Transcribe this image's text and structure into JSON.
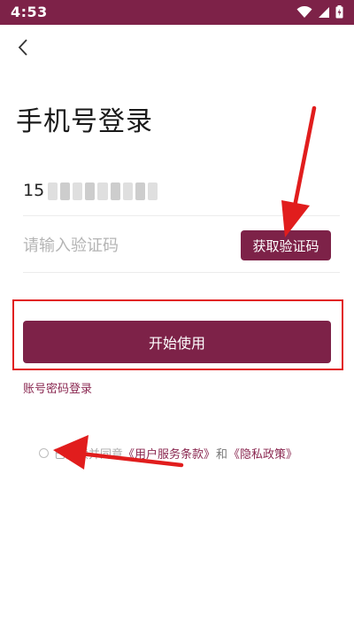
{
  "status_bar": {
    "time": "4:53",
    "icons": [
      "wifi-icon",
      "signal-icon",
      "battery-icon"
    ],
    "background": "#7d2248"
  },
  "header": {
    "back_icon": "chevron-left-icon",
    "title": "手机号登录"
  },
  "form": {
    "phone": {
      "visible_prefix": "15",
      "masked": true
    },
    "code": {
      "placeholder": "请输入验证码",
      "value": ""
    },
    "get_code_label": "获取验证码",
    "start_label": "开始使用",
    "account_login_label": "账号密码登录"
  },
  "agreement": {
    "prefix": "已阅读并同意",
    "terms_label": "《用户服务条款》",
    "and": "和",
    "privacy_label": "《隐私政策》",
    "checked": false
  },
  "colors": {
    "accent": "#7d2248",
    "link": "#8a2750",
    "annotation": "#e11d1d"
  }
}
